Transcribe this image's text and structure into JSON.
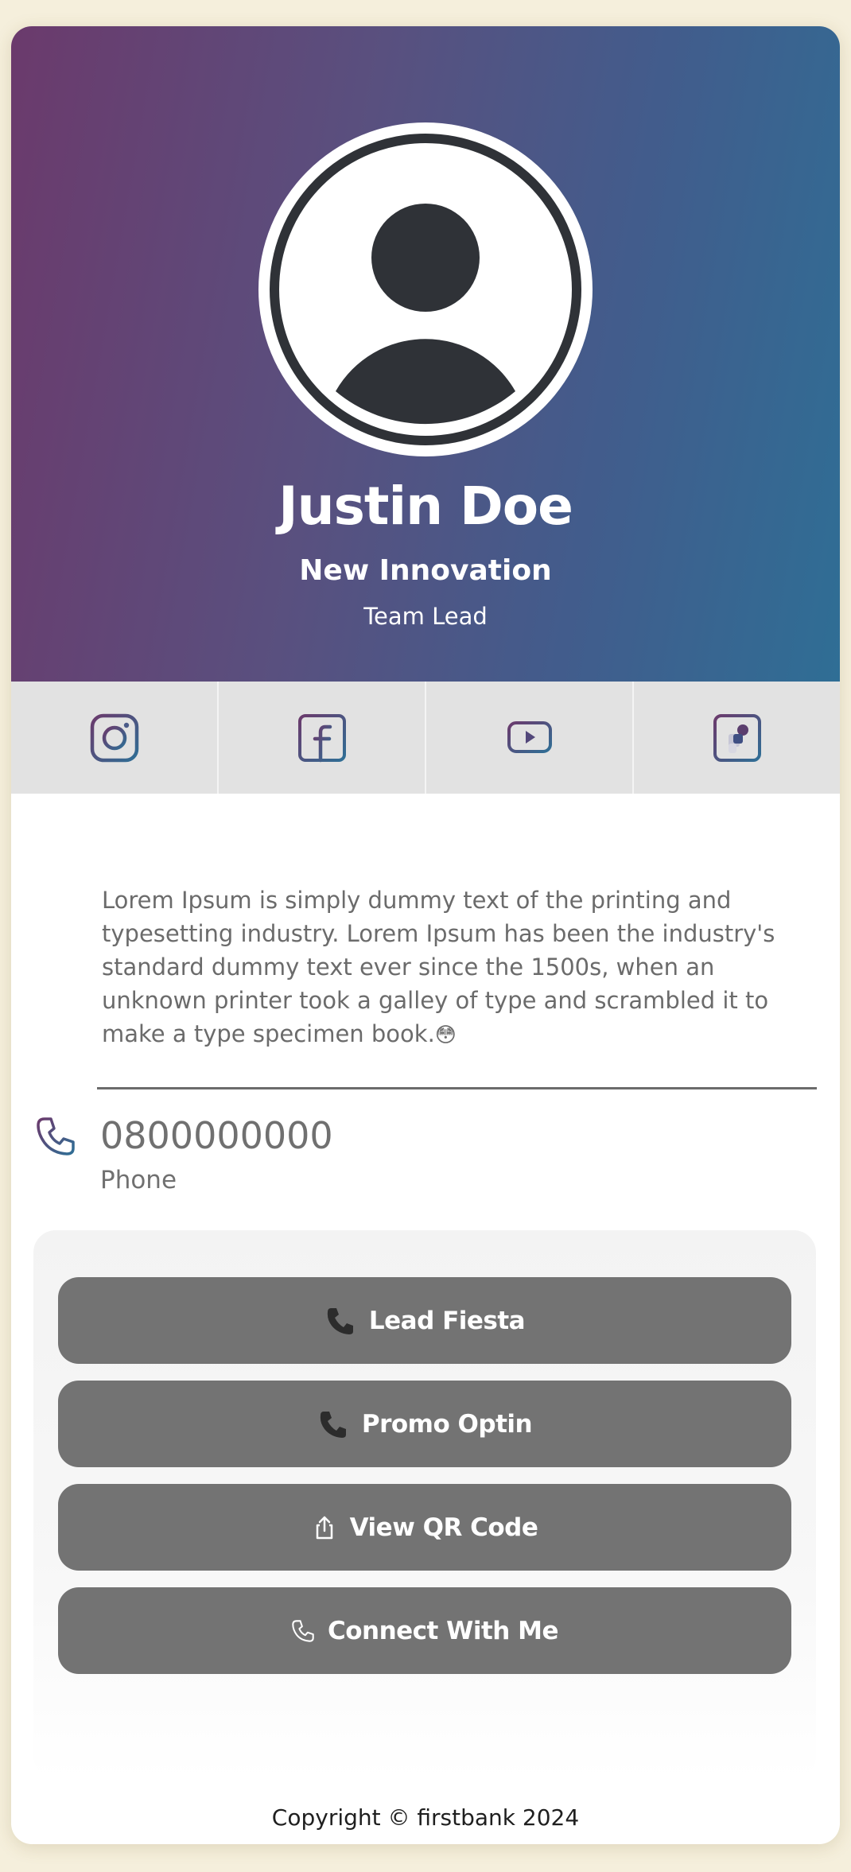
{
  "profile": {
    "name": "Justin Doe",
    "company": "New Innovation",
    "role": "Team Lead"
  },
  "social": [
    {
      "name": "instagram",
      "icon": "instagram-icon"
    },
    {
      "name": "facebook",
      "icon": "facebook-icon"
    },
    {
      "name": "youtube",
      "icon": "youtube-icon"
    },
    {
      "name": "app",
      "icon": "app-icon"
    }
  ],
  "bio": {
    "text": "Lorem Ipsum is simply dummy text of the printing and typesetting industry. Lorem Ipsum has been the industry's standard dummy text ever since the 1500s, when an unknown printer took a galley of type and scrambled it to make a type specimen book.",
    "emoji": "😳"
  },
  "contact": {
    "phone": "0800000000",
    "phone_label": "Phone",
    "icon": "phone-icon"
  },
  "buttons": {
    "lead_fiesta": "Lead Fiesta",
    "promo_optin": "Promo Optin",
    "view_qr": "View QR Code",
    "connect": "Connect With Me"
  },
  "footer": {
    "copyright": "Copyright © firstbank 2024"
  },
  "colors": {
    "gradient_start": "#6b3a6c",
    "gradient_end": "#2f6e95",
    "button_bg": "#737373",
    "page_bg": "#f5efdc"
  }
}
